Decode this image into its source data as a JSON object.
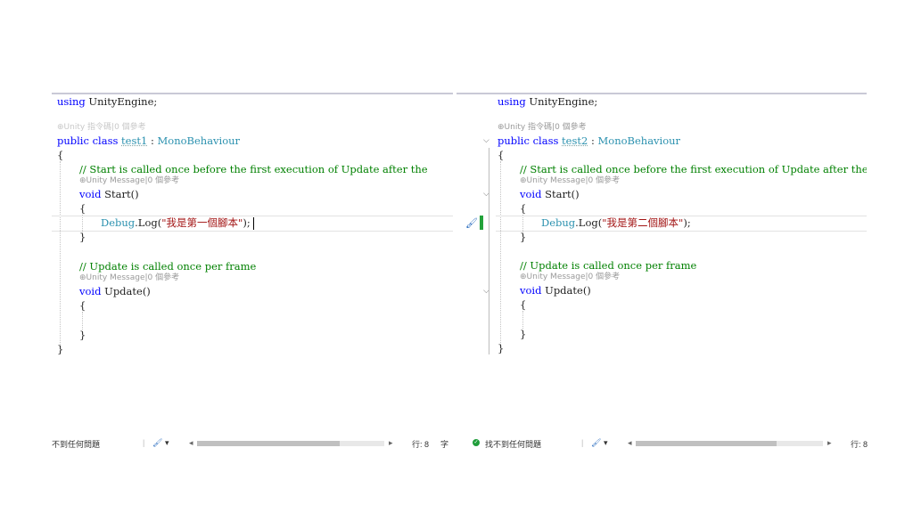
{
  "left": {
    "using_kw": "using",
    "using_rest": " UnityEngine;",
    "lens_class": "⊕Unity 指令碼|0 個參考",
    "kw_public": "public",
    "kw_class": " class ",
    "class_name": "test1",
    "colon": " : ",
    "base_class": "MonoBehaviour",
    "brace_open": "{",
    "brace_close": "}",
    "comment_start": "// Start is called once before the first execution of Update after the",
    "lens_start": "⊕Unity Message|0 個參考",
    "kw_void": "void",
    "start_name": " Start()",
    "debug_cls": "Debug",
    "log_call": ".Log(",
    "log_str": "\"我是第一個腳本\"",
    "log_end": ");",
    "comment_update": "// Update is called once per frame",
    "lens_update": "⊕Unity Message|0 個參考",
    "update_name": " Update()"
  },
  "right": {
    "using_kw": "using",
    "using_rest": " UnityEngine;",
    "lens_class": "⊕Unity 指令碼|0 個參考",
    "kw_public": "public",
    "kw_class": " class ",
    "class_name": "test2",
    "colon": " : ",
    "base_class": "MonoBehaviour",
    "brace_open": "{",
    "brace_close": "}",
    "comment_start": "// Start is called once before the first execution of Update after the",
    "lens_start": "⊕Unity Message|0 個參考",
    "kw_void": "void",
    "start_name": " Start()",
    "debug_cls": "Debug",
    "log_call": ".Log(",
    "log_str": "\"我是第二個腳本\"",
    "log_end": ");",
    "comment_update": "// Update is called once per frame",
    "lens_update": "⊕Unity Message|0 個參考",
    "update_name": " Update()"
  },
  "status_left": {
    "issues": "不到任何問題",
    "brush_icon": "brush-icon",
    "dropdown": "▾",
    "scroll_left": "◂",
    "scroll_right": "▸",
    "row_label": "行: 8",
    "char_label": "字"
  },
  "status_right": {
    "check": "✓",
    "issues": "找不到任何問題",
    "brush_icon": "brush-icon",
    "dropdown": "▾",
    "scroll_left": "◂",
    "scroll_right": "▸",
    "row_label": "行: 8"
  },
  "colors": {
    "keyword": "#0000ff",
    "type": "#2b91af",
    "comment": "#008000",
    "string": "#a31515",
    "change_bar": "#23a23a"
  }
}
